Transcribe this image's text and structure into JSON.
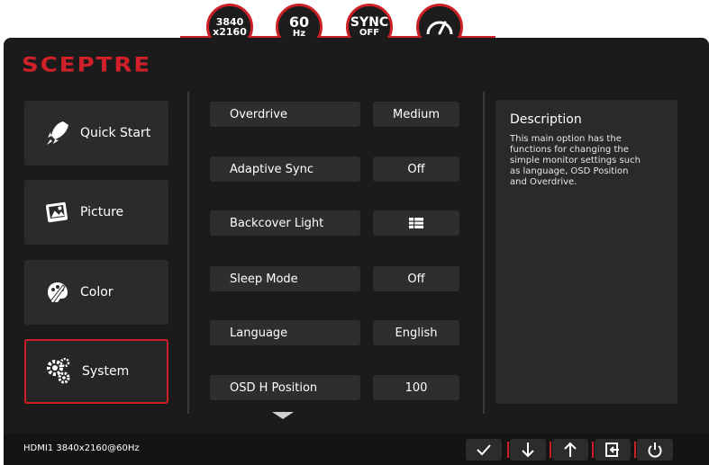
{
  "badges": [
    {
      "l1": "3840",
      "l2": "x2160",
      "icon": null
    },
    {
      "l1": "60",
      "l2": "Hz",
      "icon": null
    },
    {
      "l1": "SYNC",
      "l2": "OFF",
      "icon": null
    },
    {
      "l1": "",
      "l2": "",
      "icon": "speedometer-icon"
    }
  ],
  "brand": {
    "logo": "SCEPTRE",
    "accent": "#cc1f26"
  },
  "menu": [
    {
      "label": "Quick Start",
      "icon": "rocket-icon"
    },
    {
      "label": "Picture",
      "icon": "picture-icon"
    },
    {
      "label": "Color",
      "icon": "palette-icon"
    },
    {
      "label": "System",
      "icon": "gears-icon",
      "active": true
    }
  ],
  "options": [
    {
      "label": "Overdrive",
      "value": "Medium"
    },
    {
      "label": "Adaptive Sync",
      "value": "Off"
    },
    {
      "label": "Backcover Light",
      "value": "",
      "value_icon": "light-pattern-icon"
    },
    {
      "label": "Sleep Mode",
      "value": "Off"
    },
    {
      "label": "Language",
      "value": "English"
    },
    {
      "label": "OSD H Position",
      "value": "100"
    }
  ],
  "description": {
    "title": "Description",
    "lines": [
      "This main option has the",
      "functions for changing the",
      "simple monitor settings such",
      "as  language, OSD Position",
      "and Overdrive."
    ]
  },
  "footer": {
    "status": "HDMI1 3840x2160@60Hz",
    "controls": [
      "check-icon",
      "arrow-down-icon",
      "arrow-up-icon",
      "exit-icon",
      "power-icon"
    ]
  }
}
